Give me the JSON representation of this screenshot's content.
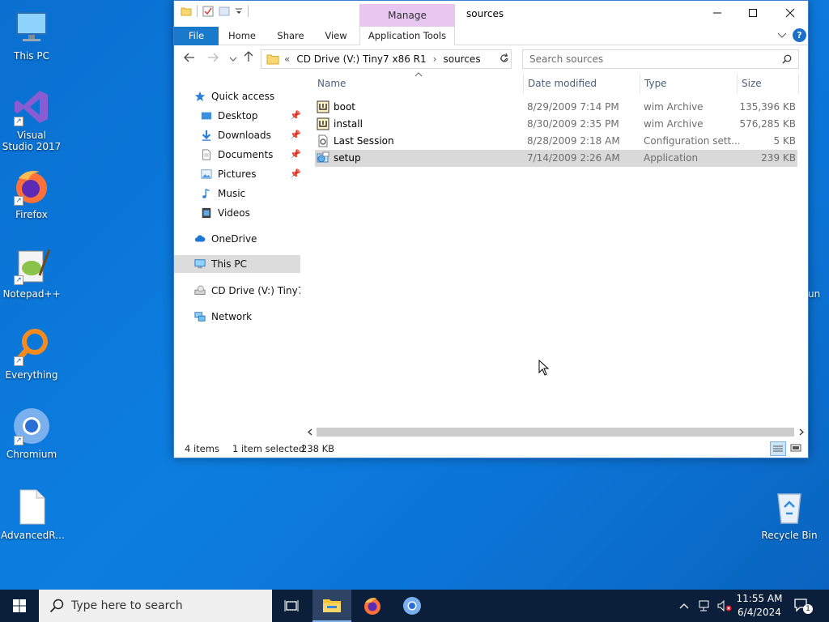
{
  "desktop": {
    "icons": [
      {
        "label": "This PC"
      },
      {
        "label": "Visual Studio 2017"
      },
      {
        "label": "Firefox"
      },
      {
        "label": "Notepad++"
      },
      {
        "label": "Everything"
      },
      {
        "label": "Chromium"
      },
      {
        "label": "AdvancedR..."
      },
      {
        "label": "Recycle Bin"
      }
    ],
    "partial_label": "un"
  },
  "window": {
    "title": "sources",
    "contextual_tab": "Manage",
    "tabs": {
      "file": "File",
      "home": "Home",
      "share": "Share",
      "view": "View",
      "app_tools": "Application Tools"
    },
    "help": "?",
    "address": {
      "prefix": "«",
      "drive": "CD Drive (V:) Tiny7 x86 R1",
      "sep": "›",
      "folder": "sources"
    },
    "search_placeholder": "Search sources",
    "nav": {
      "quick_access": "Quick access",
      "desktop": "Desktop",
      "downloads": "Downloads",
      "documents": "Documents",
      "pictures": "Pictures",
      "music": "Music",
      "videos": "Videos",
      "onedrive": "OneDrive",
      "this_pc": "This PC",
      "cd_drive": "CD Drive (V:) Tiny7 x8",
      "network": "Network"
    },
    "columns": {
      "name": "Name",
      "date": "Date modified",
      "type": "Type",
      "size": "Size"
    },
    "files": [
      {
        "name": "boot",
        "date": "8/29/2009 7:14 PM",
        "type": "wim Archive",
        "size": "135,396 KB"
      },
      {
        "name": "install",
        "date": "8/30/2009 2:35 PM",
        "type": "wim Archive",
        "size": "576,285 KB"
      },
      {
        "name": "Last Session",
        "date": "8/28/2009 2:18 AM",
        "type": "Configuration sett...",
        "size": "5 KB"
      },
      {
        "name": "setup",
        "date": "7/14/2009 2:26 AM",
        "type": "Application",
        "size": "239 KB"
      }
    ],
    "status": {
      "items": "4 items",
      "selected": "1 item selected",
      "size": "238 KB"
    }
  },
  "taskbar": {
    "search_placeholder": "Type here to search",
    "time": "11:55 AM",
    "date": "6/4/2024",
    "notification_count": "1"
  },
  "colors": {
    "accent": "#1979ca",
    "selection": "#d9d9d9",
    "manage_tab": "#e7c6f0",
    "taskbar": "#0b1f3a"
  }
}
